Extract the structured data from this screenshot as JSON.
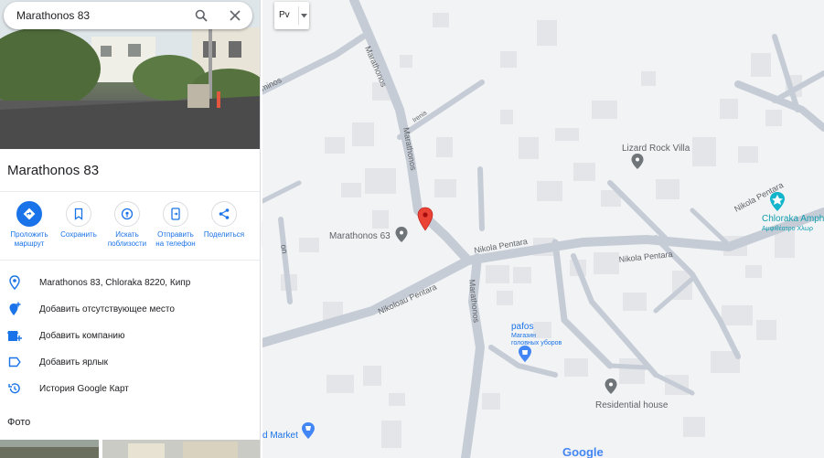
{
  "search": {
    "value": "Marathonos 83"
  },
  "place": {
    "title": "Marathonos 83"
  },
  "actions": [
    {
      "label": "Проложить\nмаршрут",
      "icon": "directions-icon"
    },
    {
      "label": "Сохранить",
      "icon": "bookmark-icon"
    },
    {
      "label": "Искать\nпоблизости",
      "icon": "nearby-icon"
    },
    {
      "label": "Отправить\nна телефон",
      "icon": "send-to-phone-icon"
    },
    {
      "label": "Поделиться",
      "icon": "share-icon"
    }
  ],
  "info": [
    {
      "text": "Marathonos 83, Chloraka 8220, Кипр",
      "icon": "location-pin-icon"
    },
    {
      "text": "Добавить отсутствующее место",
      "icon": "add-place-icon"
    },
    {
      "text": "Добавить компанию",
      "icon": "add-business-icon"
    },
    {
      "text": "Добавить ярлык",
      "icon": "label-icon"
    },
    {
      "text": "История Google Карт",
      "icon": "history-icon"
    }
  ],
  "photos": {
    "section_title": "Фото"
  },
  "map": {
    "layer_select": "Pv",
    "streets": {
      "marathonos_upper": "Marathonos",
      "marathonos_lower": "Marathonos",
      "nikola_pentara_1": "Nikola Pentara",
      "nikola_pentara_2": "Nikola Pentara",
      "nikola_pentara_3": "Nikola Pentara",
      "nikoloau_pentara": "Nikoloau Pentara",
      "irenis": "Irenis",
      "dromos_fragment": "minos",
      "edge_fragment": "on"
    },
    "pois": {
      "marathonos63": "Marathonos 63",
      "lizard_rock": "Lizard Rock Villa",
      "chloraka_amph_1": "Chloraka Amph",
      "chloraka_amph_2": "Αμφιθέατρο Χλωρ",
      "pafos": "pafos",
      "pafos_sub_1": "Магазин",
      "pafos_sub_2": "головных уборов",
      "residential": "Residential house",
      "market": "d Market"
    },
    "google_logo": "Google",
    "colors": {
      "pin": "#ea4335",
      "poi_gray": "#70757a",
      "poi_teal": "#12b5cb",
      "poi_blue": "#4285f4",
      "road": "#c6ccd6",
      "building": "#e3e5e8"
    }
  }
}
